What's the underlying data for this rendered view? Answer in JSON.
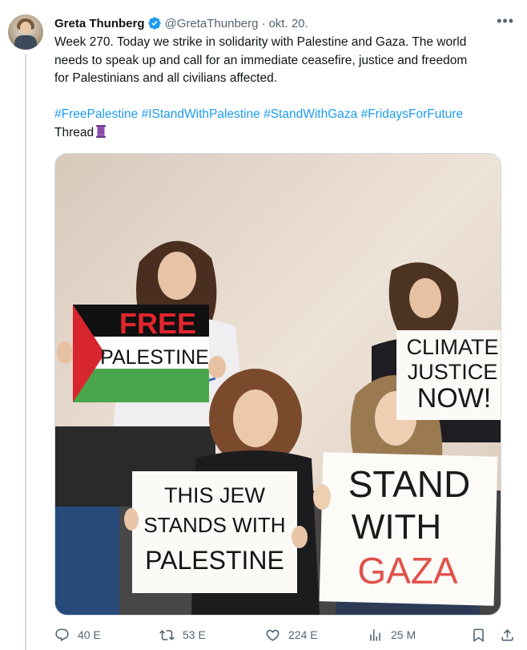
{
  "tweet": {
    "author_name": "Greta Thunberg",
    "handle": "@GretaThunberg",
    "separator": "·",
    "date": "okt. 20.",
    "text_line1": "Week 270. Today we strike in solidarity with Palestine and Gaza. The world",
    "text_line2": "needs to speak up and call for an immediate ceasefire, justice and freedom",
    "text_line3": "for Palestinians and all civilians affected.",
    "hashtags": [
      "#FreePalestine",
      "#IStandWithPalestine",
      "#StandWithGaza",
      "#FridaysForFuture"
    ],
    "thread_label": "Thread",
    "thread_emoji": "🧵",
    "more_label": "•••"
  },
  "media": {
    "sign_free_palestine": [
      "FREE",
      "PALESTINE"
    ],
    "sign_climate": [
      "CLIMATE",
      "JUSTICE",
      "NOW!"
    ],
    "sign_jew": [
      "THIS JEW",
      "STANDS WITH",
      "PALESTINE"
    ],
    "sign_gaza": [
      "STAND",
      "WITH",
      "GAZA"
    ]
  },
  "actions": {
    "replies": "40 E",
    "retweets": "53 E",
    "likes": "224 E",
    "views": "25 M"
  },
  "colors": {
    "link": "#1d9bf0",
    "muted": "#536471",
    "verified": "#1d9bf0"
  }
}
